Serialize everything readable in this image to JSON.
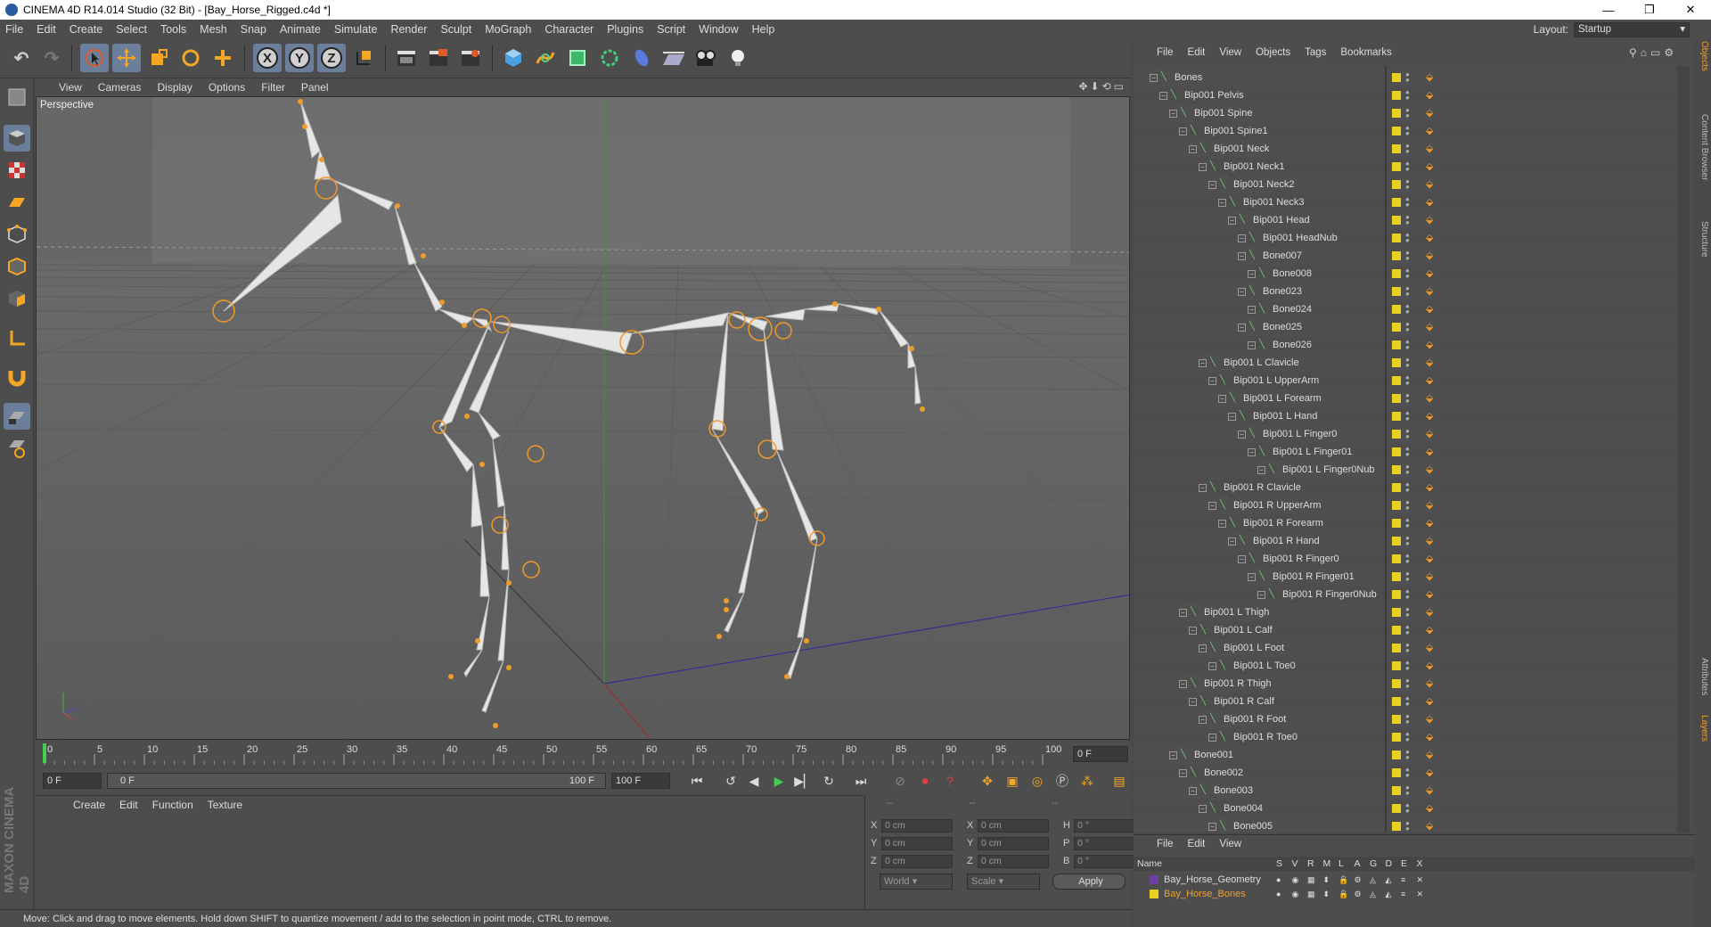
{
  "window": {
    "title": "CINEMA 4D R14.014 Studio (32 Bit) - [Bay_Horse_Rigged.c4d *]",
    "controls": [
      "—",
      "❐",
      "✕"
    ]
  },
  "menu": [
    "File",
    "Edit",
    "Create",
    "Select",
    "Tools",
    "Mesh",
    "Snap",
    "Animate",
    "Simulate",
    "Render",
    "Sculpt",
    "MoGraph",
    "Character",
    "Plugins",
    "Script",
    "Window",
    "Help"
  ],
  "layout": {
    "label": "Layout:",
    "value": "Startup"
  },
  "toolbar": {
    "undo": "↶",
    "redo": "↷",
    "x": "X",
    "y": "Y",
    "z": "Z"
  },
  "viewport": {
    "menu": [
      "View",
      "Cameras",
      "Display",
      "Options",
      "Filter",
      "Panel"
    ],
    "label": "Perspective",
    "icons": "✥⬇⟲▭"
  },
  "timeline": {
    "ticks": [
      "0",
      "5",
      "10",
      "15",
      "20",
      "25",
      "30",
      "35",
      "40",
      "45",
      "50",
      "55",
      "60",
      "65",
      "70",
      "75",
      "80",
      "85",
      "90",
      "95",
      "100"
    ],
    "current": "0 F"
  },
  "transport": {
    "start": "0 F",
    "range_start": "0 F",
    "range_end": "100 F",
    "end": "100 F"
  },
  "material": {
    "menu": [
      "Create",
      "Edit",
      "Function",
      "Texture"
    ]
  },
  "coords": {
    "headers": [
      "--",
      "--",
      "--"
    ],
    "rows": [
      {
        "a1": "X",
        "v1": "0 cm",
        "a2": "X",
        "v2": "0 cm",
        "a3": "H",
        "v3": "0 °"
      },
      {
        "a1": "Y",
        "v1": "0 cm",
        "a2": "Y",
        "v2": "0 cm",
        "a3": "P",
        "v3": "0 °"
      },
      {
        "a1": "Z",
        "v1": "0 cm",
        "a2": "Z",
        "v2": "0 cm",
        "a3": "B",
        "v3": "0 °"
      }
    ],
    "world": "World",
    "scale": "Scale",
    "apply": "Apply"
  },
  "status": "Move: Click and drag to move elements. Hold down SHIFT to quantize movement / add to the selection in point mode, CTRL to remove.",
  "objects": {
    "menu": [
      "File",
      "Edit",
      "View",
      "Objects",
      "Tags",
      "Bookmarks"
    ],
    "items": [
      {
        "name": "Bones",
        "depth": 0
      },
      {
        "name": "Bip001 Pelvis",
        "depth": 1
      },
      {
        "name": "Bip001 Spine",
        "depth": 2
      },
      {
        "name": "Bip001 Spine1",
        "depth": 3
      },
      {
        "name": "Bip001 Neck",
        "depth": 4
      },
      {
        "name": "Bip001 Neck1",
        "depth": 5
      },
      {
        "name": "Bip001 Neck2",
        "depth": 6
      },
      {
        "name": "Bip001 Neck3",
        "depth": 7
      },
      {
        "name": "Bip001 Head",
        "depth": 8
      },
      {
        "name": "Bip001 HeadNub",
        "depth": 9
      },
      {
        "name": "Bone007",
        "depth": 9
      },
      {
        "name": "Bone008",
        "depth": 10
      },
      {
        "name": "Bone023",
        "depth": 9
      },
      {
        "name": "Bone024",
        "depth": 10
      },
      {
        "name": "Bone025",
        "depth": 9
      },
      {
        "name": "Bone026",
        "depth": 10
      },
      {
        "name": "Bip001 L Clavicle",
        "depth": 5
      },
      {
        "name": "Bip001 L UpperArm",
        "depth": 6
      },
      {
        "name": "Bip001 L Forearm",
        "depth": 7
      },
      {
        "name": "Bip001 L Hand",
        "depth": 8
      },
      {
        "name": "Bip001 L Finger0",
        "depth": 9
      },
      {
        "name": "Bip001 L Finger01",
        "depth": 10
      },
      {
        "name": "Bip001 L Finger0Nub",
        "depth": 11
      },
      {
        "name": "Bip001 R Clavicle",
        "depth": 5
      },
      {
        "name": "Bip001 R UpperArm",
        "depth": 6
      },
      {
        "name": "Bip001 R Forearm",
        "depth": 7
      },
      {
        "name": "Bip001 R Hand",
        "depth": 8
      },
      {
        "name": "Bip001 R Finger0",
        "depth": 9
      },
      {
        "name": "Bip001 R Finger01",
        "depth": 10
      },
      {
        "name": "Bip001 R Finger0Nub",
        "depth": 11
      },
      {
        "name": "Bip001 L Thigh",
        "depth": 3
      },
      {
        "name": "Bip001 L Calf",
        "depth": 4
      },
      {
        "name": "Bip001 L Foot",
        "depth": 5
      },
      {
        "name": "Bip001 L Toe0",
        "depth": 6
      },
      {
        "name": "Bip001 R Thigh",
        "depth": 3
      },
      {
        "name": "Bip001 R Calf",
        "depth": 4
      },
      {
        "name": "Bip001 R Foot",
        "depth": 5
      },
      {
        "name": "Bip001 R Toe0",
        "depth": 6
      },
      {
        "name": "Bone001",
        "depth": 2
      },
      {
        "name": "Bone002",
        "depth": 3
      },
      {
        "name": "Bone003",
        "depth": 4
      },
      {
        "name": "Bone004",
        "depth": 5
      },
      {
        "name": "Bone005",
        "depth": 6
      }
    ]
  },
  "layers": {
    "menu": [
      "File",
      "Edit",
      "View"
    ],
    "headers": [
      "Name",
      "S",
      "V",
      "R",
      "M",
      "L",
      "A",
      "G",
      "D",
      "E",
      "X"
    ],
    "rows": [
      {
        "name": "Bay_Horse_Geometry",
        "color": "#6b3fa0",
        "text_color": "#dddddd"
      },
      {
        "name": "Bay_Horse_Bones",
        "color": "#e8d21e",
        "text_color": "#f0a030"
      }
    ]
  },
  "side_tabs": [
    "Objects",
    "Content Browser",
    "Structure",
    "Attributes",
    "Layers"
  ],
  "colors": {
    "accent": "#6b7e9c",
    "tag_yellow": "#e8d21e",
    "bone_orange": "#f09a2a"
  }
}
